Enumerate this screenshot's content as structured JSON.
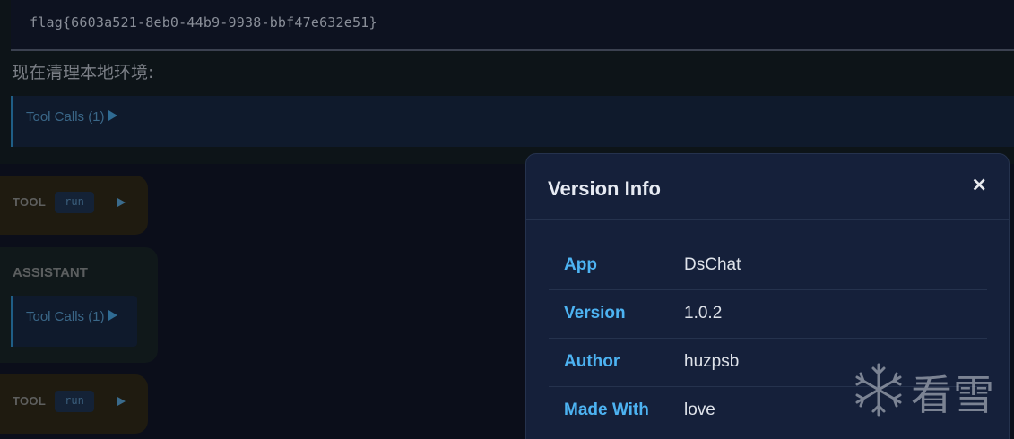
{
  "chat": {
    "flag_line": "flag{6603a521-8eb0-44b9-9938-bbf47e632e51}",
    "cleanup_text": "现在清理本地环境:",
    "tool_calls_label": "Tool Calls (1)",
    "tool_label": "TOOL",
    "run_badge": "run",
    "assistant_label": "ASSISTANT"
  },
  "modal": {
    "title": "Version Info",
    "close_icon": "×",
    "rows": [
      {
        "key": "App",
        "value": "DsChat"
      },
      {
        "key": "Version",
        "value": "1.0.2"
      },
      {
        "key": "Author",
        "value": "huzpsb"
      },
      {
        "key": "Made With",
        "value": "love"
      }
    ]
  },
  "watermark": {
    "text": "看雪",
    "icon": "snowflake-icon"
  },
  "colors": {
    "accent": "#4db3f2",
    "modal_bg": "#15203a",
    "page_bg": "#0b0e1a"
  }
}
